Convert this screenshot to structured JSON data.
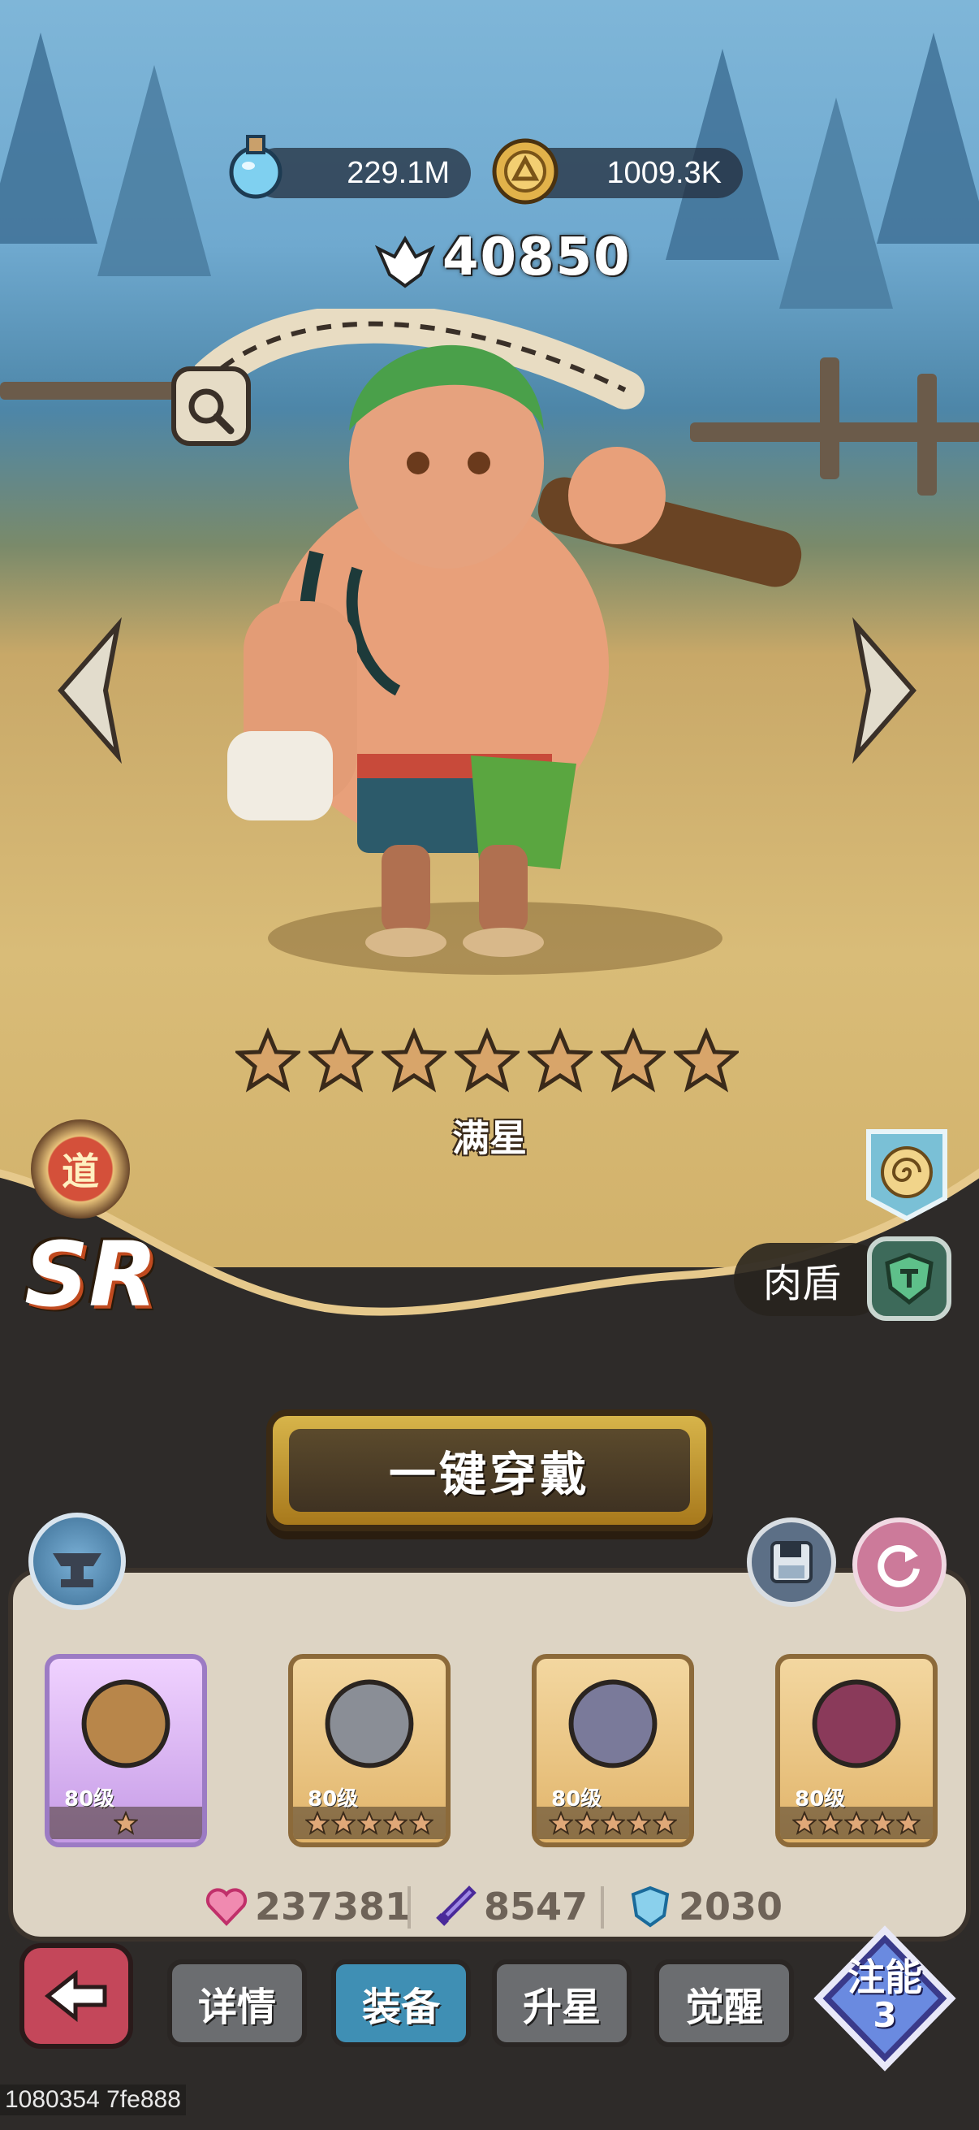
{
  "resources": {
    "potion_value": "229.1M",
    "coin_value": "1009.3K",
    "potion_icon": "potion-icon",
    "coin_icon": "gold-coin-icon"
  },
  "hero": {
    "power": "40850",
    "star_count": 7,
    "star_label": "满星",
    "faction_glyph": "道",
    "rarity": "SR",
    "role": "肉盾"
  },
  "actions": {
    "equip_all": "一键穿戴"
  },
  "equipment": [
    {
      "name": "hammer",
      "level": "80级",
      "stars": 1,
      "rarity": "purple"
    },
    {
      "name": "armor",
      "level": "80级",
      "stars": 5,
      "rarity": "gold"
    },
    {
      "name": "helmet",
      "level": "80级",
      "stars": 5,
      "rarity": "gold"
    },
    {
      "name": "ring",
      "level": "80级",
      "stars": 5,
      "rarity": "gold"
    }
  ],
  "stats": {
    "hp": "237381",
    "attack": "8547",
    "defense": "2030"
  },
  "tabs": [
    {
      "label": "详情",
      "active": false
    },
    {
      "label": "装备",
      "active": true
    },
    {
      "label": "升星",
      "active": false
    },
    {
      "label": "觉醒",
      "active": false
    }
  ],
  "skill_button": {
    "label": "注能",
    "count": "3"
  },
  "debug_text": "1080354 7fe888",
  "colors": {
    "active_tab": "#3f8fb4",
    "equip_button": "#c89a30",
    "stat_hp": "#e0508a",
    "stat_atk": "#7a5ad0",
    "stat_def": "#3a9ac4"
  }
}
